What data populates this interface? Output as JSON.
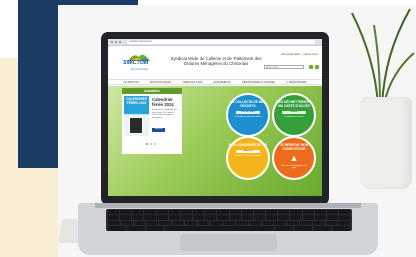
{
  "browser": {
    "url": "smictom-chinonais.fr"
  },
  "site": {
    "logo_text": "SMICTOM",
    "logo_sub": "du Chinonais",
    "title": "Syndicat Mixte de Collecte et de Traitement des Ordures Ménagères du Chinonais",
    "top_links": [
      "Demande aides",
      "Nous écrire"
    ],
    "search_placeholder": "Rechercher"
  },
  "nav": [
    "LE SMICTOM",
    "INFOS PRATIQUES",
    "TRIER PAS A PAS",
    "ÉQUIPEMENTS",
    "DÉCHETTERIES & CENTRES",
    "À TÉLÉCHARGER"
  ],
  "actualites": {
    "header": "Actualités",
    "calendar_cover": "CALENDRIER FÉRIÉS 2024",
    "headline": "Calendrier fériés 2024",
    "text": "Retrouvez le calendrier des jours fériés 2024 pour la collecte de vos ordures ménagères.",
    "button": "Voir plus"
  },
  "tiles": [
    {
      "title": "LA COLLECTE DE MES DÉCHETS",
      "button": "Jours de collecte",
      "sub": "Consulter les jours de collecte"
    },
    {
      "title": "MES DÉCHETTERIES & MA CARTE D'ACCÈS",
      "button": "Horaires",
      "sub": "Consulter les horaires"
    },
    {
      "title": "MES CONSIGNES DE TRI",
      "button": "Guide du tri",
      "sub": "Un doute ? Consultez le guide"
    },
    {
      "title": "JE RÉSERVE MON COMPOSTEUR",
      "button": "",
      "sub": "Réserver un composteur en ligne"
    }
  ],
  "colors": {
    "navy": "#1c3d63",
    "green": "#6fae2e",
    "blue": "#1d8fcf",
    "yellow": "#f3b51b",
    "orange": "#ec6b1c"
  }
}
